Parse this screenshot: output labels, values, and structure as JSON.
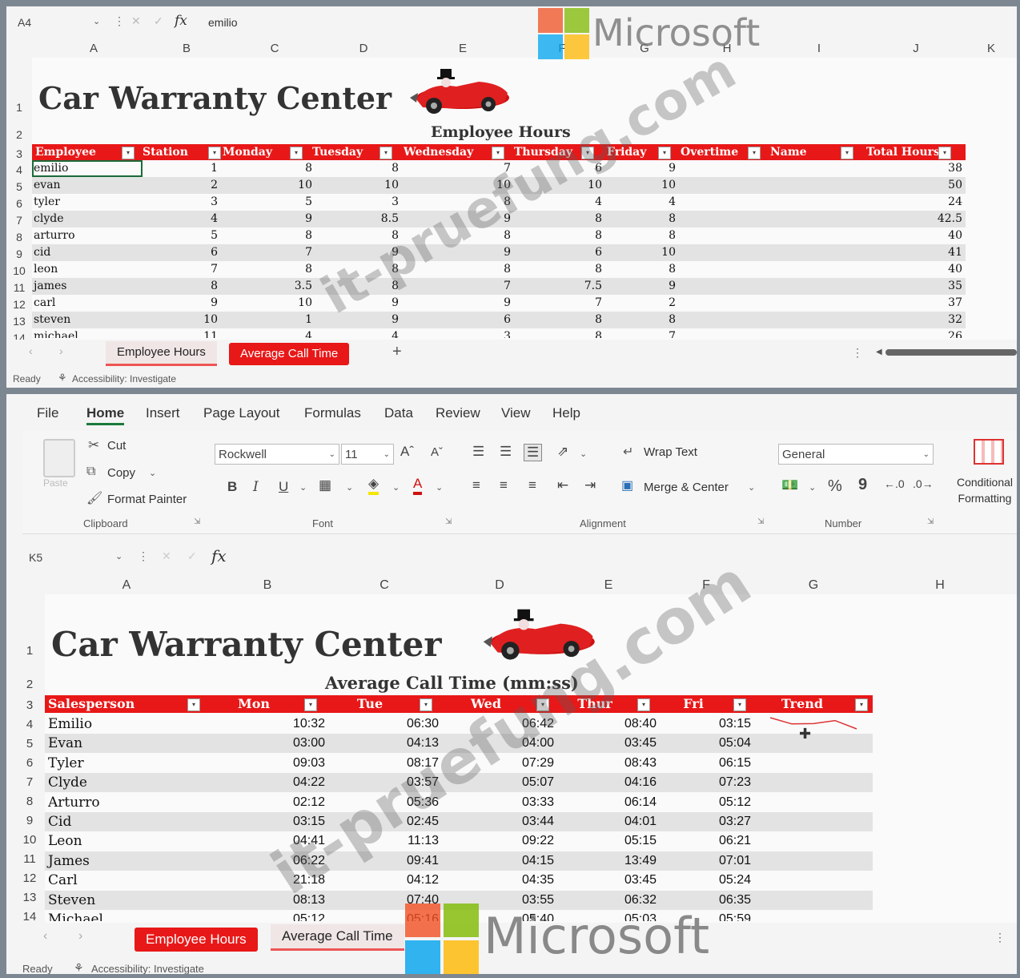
{
  "colors": {
    "header_red": "#e81818",
    "band_gray": "#e3e3e3",
    "ms_red": "#f25022",
    "ms_green": "#7fba00",
    "ms_blue": "#00a4ef",
    "ms_yellow": "#ffb900"
  },
  "top": {
    "name_box": "A4",
    "formula": "emilio",
    "columns": [
      "A",
      "B",
      "C",
      "D",
      "E",
      "F",
      "G",
      "H",
      "I",
      "J",
      "K"
    ],
    "rows": [
      "1",
      "2",
      "3",
      "4",
      "5",
      "6",
      "7",
      "8",
      "9",
      "10",
      "11",
      "12",
      "13",
      "14"
    ],
    "title": "Car Warranty Center",
    "subtitle": "Employee Hours",
    "headers": [
      "Employee",
      "Station",
      "Monday",
      "Tuesday",
      "Wednesday",
      "Thursday",
      "Friday",
      "Overtime",
      "Name",
      "Total Hours"
    ],
    "data": [
      [
        "emilio",
        "1",
        "8",
        "8",
        "7",
        "6",
        "9",
        "",
        "38"
      ],
      [
        "evan",
        "2",
        "10",
        "10",
        "10",
        "10",
        "10",
        "",
        "50"
      ],
      [
        "tyler",
        "3",
        "5",
        "3",
        "8",
        "4",
        "4",
        "",
        "24"
      ],
      [
        "clyde",
        "4",
        "9",
        "8.5",
        "9",
        "8",
        "8",
        "",
        "42.5"
      ],
      [
        "arturro",
        "5",
        "8",
        "8",
        "8",
        "8",
        "8",
        "",
        "40"
      ],
      [
        "cid",
        "6",
        "7",
        "9",
        "9",
        "6",
        "10",
        "",
        "41"
      ],
      [
        "leon",
        "7",
        "8",
        "8",
        "8",
        "8",
        "8",
        "",
        "40"
      ],
      [
        "james",
        "8",
        "3.5",
        "8",
        "7",
        "7.5",
        "9",
        "",
        "35"
      ],
      [
        "carl",
        "9",
        "10",
        "9",
        "9",
        "7",
        "2",
        "",
        "37"
      ],
      [
        "steven",
        "10",
        "1",
        "9",
        "6",
        "8",
        "8",
        "",
        "32"
      ],
      [
        "michael",
        "11",
        "4",
        "4",
        "3",
        "8",
        "7",
        "",
        "26"
      ]
    ],
    "tabs": [
      "Employee Hours",
      "Average Call Time"
    ],
    "add_sheet": "+",
    "status_ready": "Ready",
    "status_accessibility": "Accessibility: Investigate"
  },
  "bottom": {
    "ribbon_tabs": [
      "File",
      "Home",
      "Insert",
      "Page Layout",
      "Formulas",
      "Data",
      "Review",
      "View",
      "Help"
    ],
    "clipboard": {
      "paste": "Paste",
      "cut": "Cut",
      "copy": "Copy",
      "format_painter": "Format Painter",
      "group": "Clipboard"
    },
    "font": {
      "name": "Rockwell",
      "size": "11",
      "group": "Font",
      "bold": "B",
      "italic": "I",
      "underline": "U"
    },
    "alignment": {
      "wrap_text": "Wrap Text",
      "merge_center": "Merge & Center",
      "group": "Alignment"
    },
    "number": {
      "format": "General",
      "percent": "%",
      "comma": "9",
      "group": "Number"
    },
    "conditional": "Conditional Formatting",
    "name_box": "K5",
    "columns": [
      "A",
      "B",
      "C",
      "D",
      "E",
      "F",
      "G",
      "H"
    ],
    "rows": [
      "1",
      "2",
      "3",
      "4",
      "5",
      "6",
      "7",
      "8",
      "9",
      "10",
      "11",
      "12",
      "13",
      "14"
    ],
    "title": "Car Warranty Center",
    "subtitle": "Average Call Time (mm:ss)",
    "headers": [
      "Salesperson",
      "Mon",
      "Tue",
      "Wed",
      "Thur",
      "Fri",
      "Trend"
    ],
    "data": [
      [
        "Emilio",
        "10:32",
        "06:30",
        "06:42",
        "08:40",
        "03:15"
      ],
      [
        "Evan",
        "03:00",
        "04:13",
        "04:00",
        "03:45",
        "05:04"
      ],
      [
        "Tyler",
        "09:03",
        "08:17",
        "07:29",
        "08:43",
        "06:15"
      ],
      [
        "Clyde",
        "04:22",
        "03:57",
        "05:07",
        "04:16",
        "07:23"
      ],
      [
        "Arturro",
        "02:12",
        "05:36",
        "03:33",
        "06:14",
        "05:12"
      ],
      [
        "Cid",
        "03:15",
        "02:45",
        "03:44",
        "04:01",
        "03:27"
      ],
      [
        "Leon",
        "04:41",
        "11:13",
        "09:22",
        "05:15",
        "06:21"
      ],
      [
        "James",
        "06:22",
        "09:41",
        "04:15",
        "13:49",
        "07:01"
      ],
      [
        "Carl",
        "21:18",
        "04:12",
        "04:35",
        "03:45",
        "05:24"
      ],
      [
        "Steven",
        "08:13",
        "07:40",
        "03:55",
        "06:32",
        "06:35"
      ],
      [
        "Michael",
        "05:12",
        "05:16",
        "05:40",
        "05:03",
        "05:59"
      ]
    ],
    "tabs": [
      "Employee Hours",
      "Average Call Time"
    ],
    "status_ready": "Ready",
    "status_accessibility": "Accessibility: Investigate"
  },
  "watermarks": {
    "microsoft": "Microsoft",
    "site": "it-pruefung.com"
  }
}
